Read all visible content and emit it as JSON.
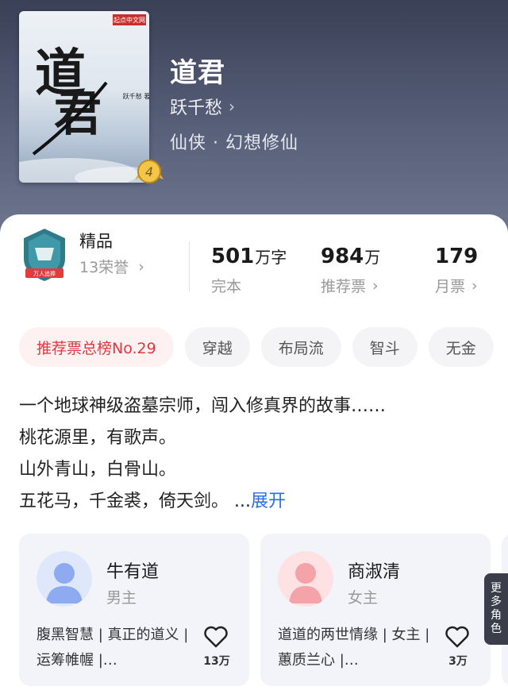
{
  "book": {
    "title": "道君",
    "author": "跃千愁",
    "genre": "仙侠 · 幻想修仙",
    "cover": {
      "title_glyphs": "道君",
      "publisher": "起点中文网",
      "author_mark": "跃千愁 著",
      "level_badge": "4"
    }
  },
  "honor": {
    "title": "精品",
    "subtitle": "13荣誉",
    "emblem_caption": "万人追捧"
  },
  "stats": [
    {
      "value": "501",
      "unit": "万字",
      "label": "完本",
      "has_arrow": false
    },
    {
      "value": "984",
      "unit": "万",
      "label": "推荐票",
      "has_arrow": true
    },
    {
      "value": "179",
      "unit": "",
      "label": "月票",
      "has_arrow": true
    }
  ],
  "tags": [
    "推荐票总榜No.29",
    "穿越",
    "布局流",
    "智斗",
    "无金"
  ],
  "description": {
    "lines": [
      "一个地球神级盗墓宗师，闯入修真界的故事……",
      "桃花源里，有歌声。",
      "山外青山，白骨山。",
      "五花马，千金裘，倚天剑。"
    ],
    "ellipsis": " ...",
    "expand_label": "展开"
  },
  "roles": [
    {
      "name": "牛有道",
      "kind": "男主",
      "desc": "腹黑智慧 | 真正的道义 | 运筹帷幄 |…",
      "likes": "13万",
      "avatar_color": "#7fa0f0"
    },
    {
      "name": "商淑清",
      "kind": "女主",
      "desc": "道道的两世情缘 | 女主 | 蕙质兰心 |…",
      "likes": "3万",
      "avatar_color": "#f28a90"
    }
  ],
  "more_roles": [
    "更",
    "多",
    "角",
    "色"
  ],
  "icons": {
    "chevron": "chevron-right-icon",
    "heart": "heart-outline-icon",
    "badge": "level-badge-icon",
    "emblem": "honor-emblem-icon"
  },
  "colors": {
    "accent_red": "#e0383e",
    "link_blue": "#2b6de8",
    "badge_gold": "#e6b23a"
  }
}
